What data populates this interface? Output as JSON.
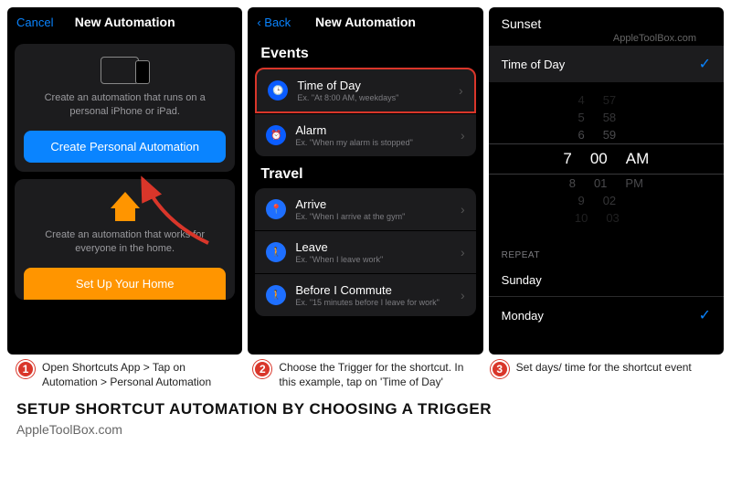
{
  "watermark": "AppleToolBox.com",
  "panel1": {
    "nav_cancel": "Cancel",
    "nav_title": "New Automation",
    "card1_desc": "Create an automation that runs on a personal iPhone or iPad.",
    "card1_btn": "Create Personal Automation",
    "card2_desc": "Create an automation that works for everyone in the home.",
    "card2_btn": "Set Up Your Home"
  },
  "panel2": {
    "nav_back": "Back",
    "nav_title": "New Automation",
    "section_events": "Events",
    "row_time": {
      "title": "Time of Day",
      "sub": "Ex. \"At 8:00 AM, weekdays\""
    },
    "row_alarm": {
      "title": "Alarm",
      "sub": "Ex. \"When my alarm is stopped\""
    },
    "section_travel": "Travel",
    "row_arrive": {
      "title": "Arrive",
      "sub": "Ex. \"When I arrive at the gym\""
    },
    "row_leave": {
      "title": "Leave",
      "sub": "Ex. \"When I leave work\""
    },
    "row_commute": {
      "title": "Before I Commute",
      "sub": "Ex. \"15 minutes before I leave for work\""
    }
  },
  "panel3": {
    "sunset": "Sunset",
    "timeofday": "Time of Day",
    "picker": {
      "r1": [
        "4",
        "57",
        ""
      ],
      "r2": [
        "5",
        "58",
        ""
      ],
      "r3": [
        "6",
        "59",
        ""
      ],
      "sel": [
        "7",
        "00",
        "AM"
      ],
      "r5": [
        "8",
        "01",
        "PM"
      ],
      "r6": [
        "9",
        "02",
        ""
      ],
      "r7": [
        "10",
        "03",
        ""
      ]
    },
    "repeat_label": "REPEAT",
    "sunday": "Sunday",
    "monday": "Monday"
  },
  "captions": {
    "c1": "Open Shortcuts App > Tap on Automation > Personal Automation",
    "c2": "Choose the Trigger for the shortcut. In this example, tap on 'Time of Day'",
    "c3": "Set days/ time for the shortcut event"
  },
  "headline": "SETUP SHORTCUT AUTOMATION BY CHOOSING A TRIGGER",
  "footer": "AppleToolBox.com"
}
